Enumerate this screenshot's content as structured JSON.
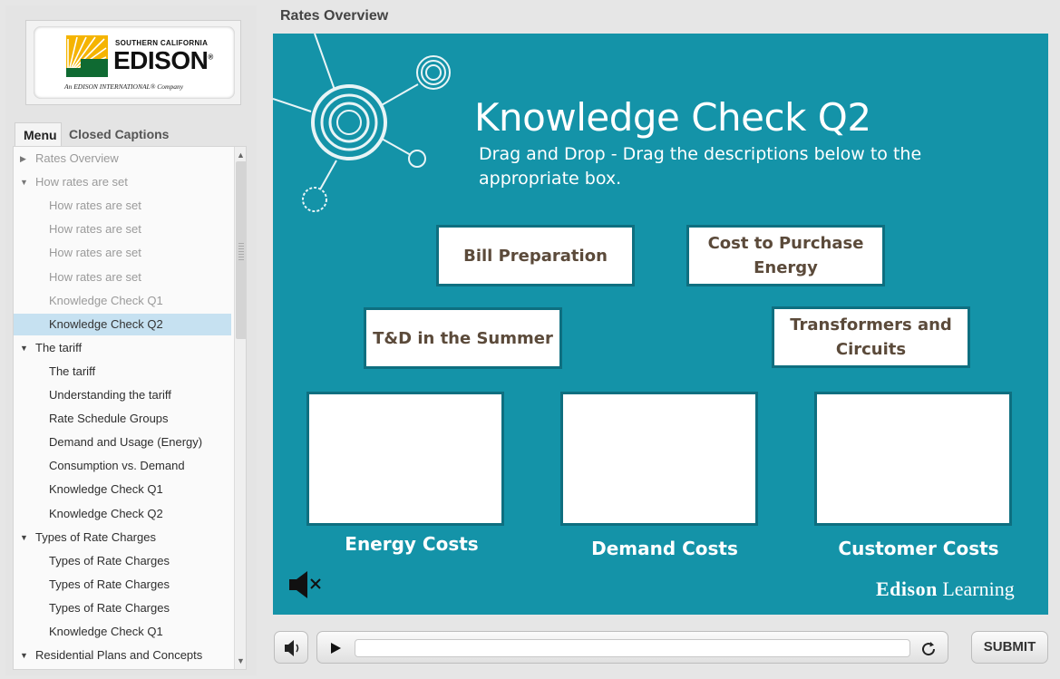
{
  "logo": {
    "line1": "SOUTHERN CALIFORNIA",
    "line2": "EDISON",
    "line2_mark": "®",
    "line3": "An EDISON INTERNATIONAL® Company"
  },
  "tabs": {
    "menu": "Menu",
    "closed_captions": "Closed Captions"
  },
  "menu": {
    "items": [
      {
        "label": "Rates Overview",
        "arrow": "▶",
        "level": 0,
        "state": "dim"
      },
      {
        "label": "How rates are set",
        "arrow": "▼",
        "level": 0,
        "state": "dim"
      },
      {
        "label": "How rates are set",
        "arrow": "",
        "level": 1,
        "state": "dim"
      },
      {
        "label": "How rates are set",
        "arrow": "",
        "level": 1,
        "state": "dim"
      },
      {
        "label": "How rates are set",
        "arrow": "",
        "level": 1,
        "state": "dim"
      },
      {
        "label": "How rates are set",
        "arrow": "",
        "level": 1,
        "state": "dim"
      },
      {
        "label": "Knowledge Check Q1",
        "arrow": "",
        "level": 1,
        "state": "dim"
      },
      {
        "label": "Knowledge Check Q2",
        "arrow": "",
        "level": 1,
        "state": "selected"
      },
      {
        "label": "The tariff",
        "arrow": "▼",
        "level": 0,
        "state": "dark"
      },
      {
        "label": "The tariff",
        "arrow": "",
        "level": 1,
        "state": "dark"
      },
      {
        "label": "Understanding the tariff",
        "arrow": "",
        "level": 1,
        "state": "dark"
      },
      {
        "label": "Rate Schedule Groups",
        "arrow": "",
        "level": 1,
        "state": "dark"
      },
      {
        "label": "Demand and Usage (Energy)",
        "arrow": "",
        "level": 1,
        "state": "dark"
      },
      {
        "label": "Consumption vs. Demand",
        "arrow": "",
        "level": 1,
        "state": "dark"
      },
      {
        "label": "Knowledge Check Q1",
        "arrow": "",
        "level": 1,
        "state": "dark"
      },
      {
        "label": "Knowledge Check Q2",
        "arrow": "",
        "level": 1,
        "state": "dark"
      },
      {
        "label": "Types of Rate Charges",
        "arrow": "▼",
        "level": 0,
        "state": "dark"
      },
      {
        "label": "Types of Rate Charges",
        "arrow": "",
        "level": 1,
        "state": "dark"
      },
      {
        "label": "Types of Rate Charges",
        "arrow": "",
        "level": 1,
        "state": "dark"
      },
      {
        "label": "Types of Rate Charges",
        "arrow": "",
        "level": 1,
        "state": "dark"
      },
      {
        "label": "Knowledge Check Q1",
        "arrow": "",
        "level": 1,
        "state": "dark"
      },
      {
        "label": "Residential Plans and Concepts",
        "arrow": "▼",
        "level": 0,
        "state": "dark"
      }
    ]
  },
  "header": {
    "title": "Rates Overview"
  },
  "slide": {
    "title": "Knowledge Check Q2",
    "subtitle": "Drag and Drop - Drag the descriptions below to the appropriate box.",
    "drag_items": {
      "bill": "Bill Preparation",
      "purchase": "Cost to Purchase Energy",
      "td": "T&D in the Summer",
      "transformers": "Transformers and Circuits"
    },
    "targets": {
      "energy": "Energy Costs",
      "demand": "Demand Costs",
      "customer": "Customer Costs"
    },
    "brand_bold": "Edison",
    "brand_rest": "Learning"
  },
  "player": {
    "submit_label": "SUBMIT"
  },
  "icons": {
    "volume": "speaker-icon",
    "mute": "speaker-muted-icon",
    "play": "play-icon",
    "replay": "replay-icon"
  },
  "colors": {
    "slide_bg": "#1493a8",
    "box_border": "#0e6f80",
    "drag_text": "#5b4a3a",
    "selected_row": "#c6e1f1"
  }
}
